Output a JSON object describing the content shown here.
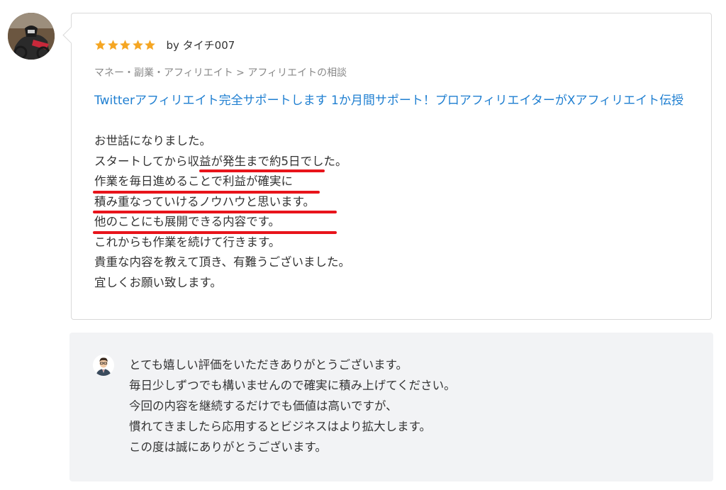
{
  "review": {
    "rating": 5,
    "star_color": "#f5a623",
    "by_text": "by タイチ007",
    "category": "マネー・副業・アフィリエイト > アフィリエイトの相談",
    "service_title": "Twitterアフィリエイト完全サポートします 1か月間サポート！プロアフィリエイターがXアフィリエイト伝授",
    "body_lines": [
      "お世話になりました。",
      "スタートしてから収益が発生まで約5日でした。",
      "作業を毎日進めることで利益が確実に",
      "積み重なっていけるノウハウと思います。",
      "他のことにも展開できる内容です。",
      "これからも作業を続けて行きます。",
      "貴重な内容を教えて頂き、有難うございました。",
      "宜しくお願い致します。"
    ],
    "highlight_color": "#e8141b",
    "link_color": "#1f7fd1"
  },
  "reply": {
    "body_lines": [
      "とても嬉しい評価をいただきありがとうございます。",
      "毎日少しずつでも構いませんので確実に積み上げてください。",
      "今回の内容を継続するだけでも価値は高いですが、",
      "慣れてきましたら応用するとビジネスはより拡大します。",
      "この度は誠にありがとうございます。"
    ]
  }
}
